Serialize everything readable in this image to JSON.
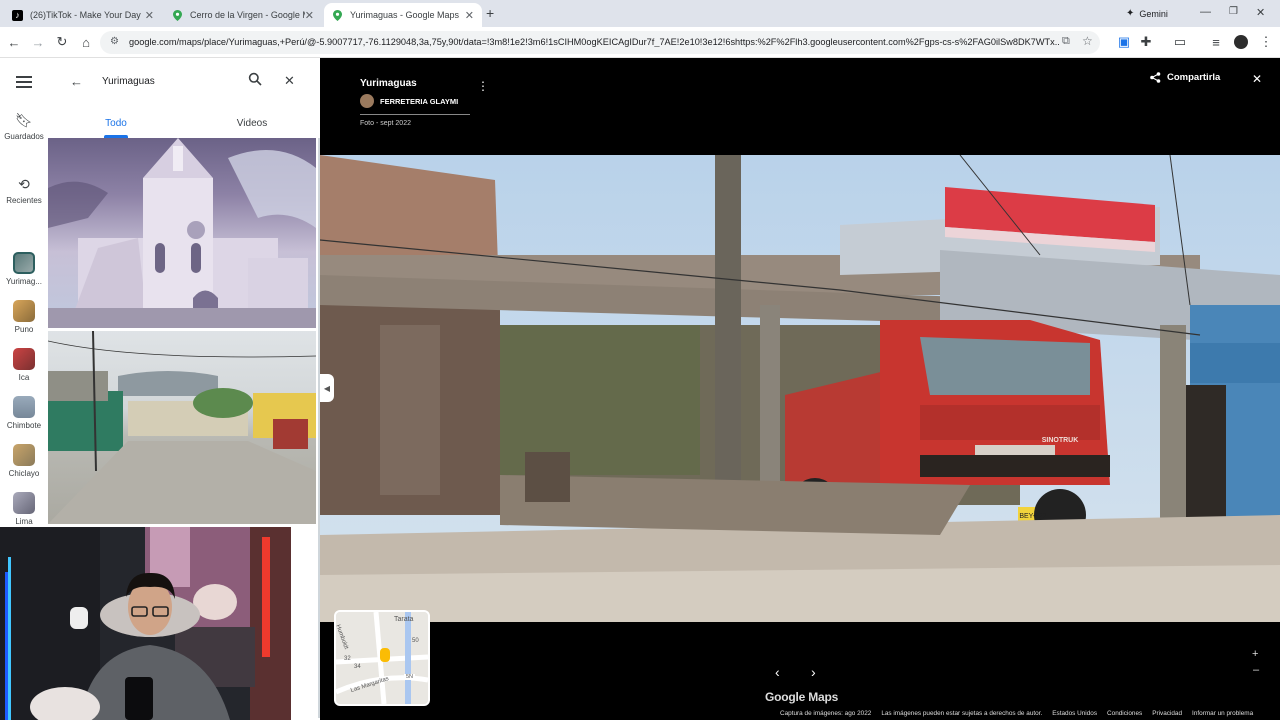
{
  "browser": {
    "tabs": [
      {
        "title": "(26)TikTok - Make Your Day",
        "icon": "tiktok-icon"
      },
      {
        "title": "Cerro de la Virgen - Google M",
        "icon": "maps-pin-icon"
      },
      {
        "title": "Yurimaguas - Google Maps",
        "icon": "maps-pin-icon"
      }
    ],
    "new_tab": "+",
    "gemini_label": "Gemini",
    "url": "google.com/maps/place/Yurimaguas,+Perú/@-5.9007717,-76.1129048,3a,75y,90t/data=!3m8!1e2!3m6!1sCIHM0ogKEICAgIDur7f_7AE!2e10!3e12!6shttps:%2F%2Flh3.googleusercontent.com%2Fgps-cs-s%2FAG0ilSw8DK7WTx..."
  },
  "rail": {
    "menu_icon": "menu-icon",
    "saved_label": "Guardados",
    "recent_label": "Recientes",
    "places": [
      "Yurimag...",
      "Puno",
      "Ica",
      "Chimbote",
      "Chiclayo",
      "Lima"
    ]
  },
  "search": {
    "query": "Yurimaguas",
    "tabs": [
      "Todo",
      "Videos"
    ],
    "active_tab": "Todo"
  },
  "viewer": {
    "place_title": "Yurimaguas",
    "contributor": "FERRETERIA GLAYMI",
    "photo_date": "Foto - sept 2022",
    "share_label": "Compartirla",
    "brand": "Google Maps",
    "minimap_labels": [
      "Tarata",
      "Humboldt",
      "50",
      "32",
      "34",
      "Las Margaritas",
      "5N"
    ],
    "plate": "BEY-922",
    "truck_brand": "SINOTRUK",
    "footer": [
      "Captura de imágenes: ago 2022",
      "Las imágenes pueden estar sujetas a derechos de autor.",
      "Estados Unidos",
      "Condiciones",
      "Privacidad",
      "Informar un problema"
    ]
  },
  "colors": {
    "tab_strip": "#dfe3eb",
    "maps_blue": "#1a73e8",
    "truck_red": "#c0322b",
    "viewer_bg": "#000000"
  }
}
